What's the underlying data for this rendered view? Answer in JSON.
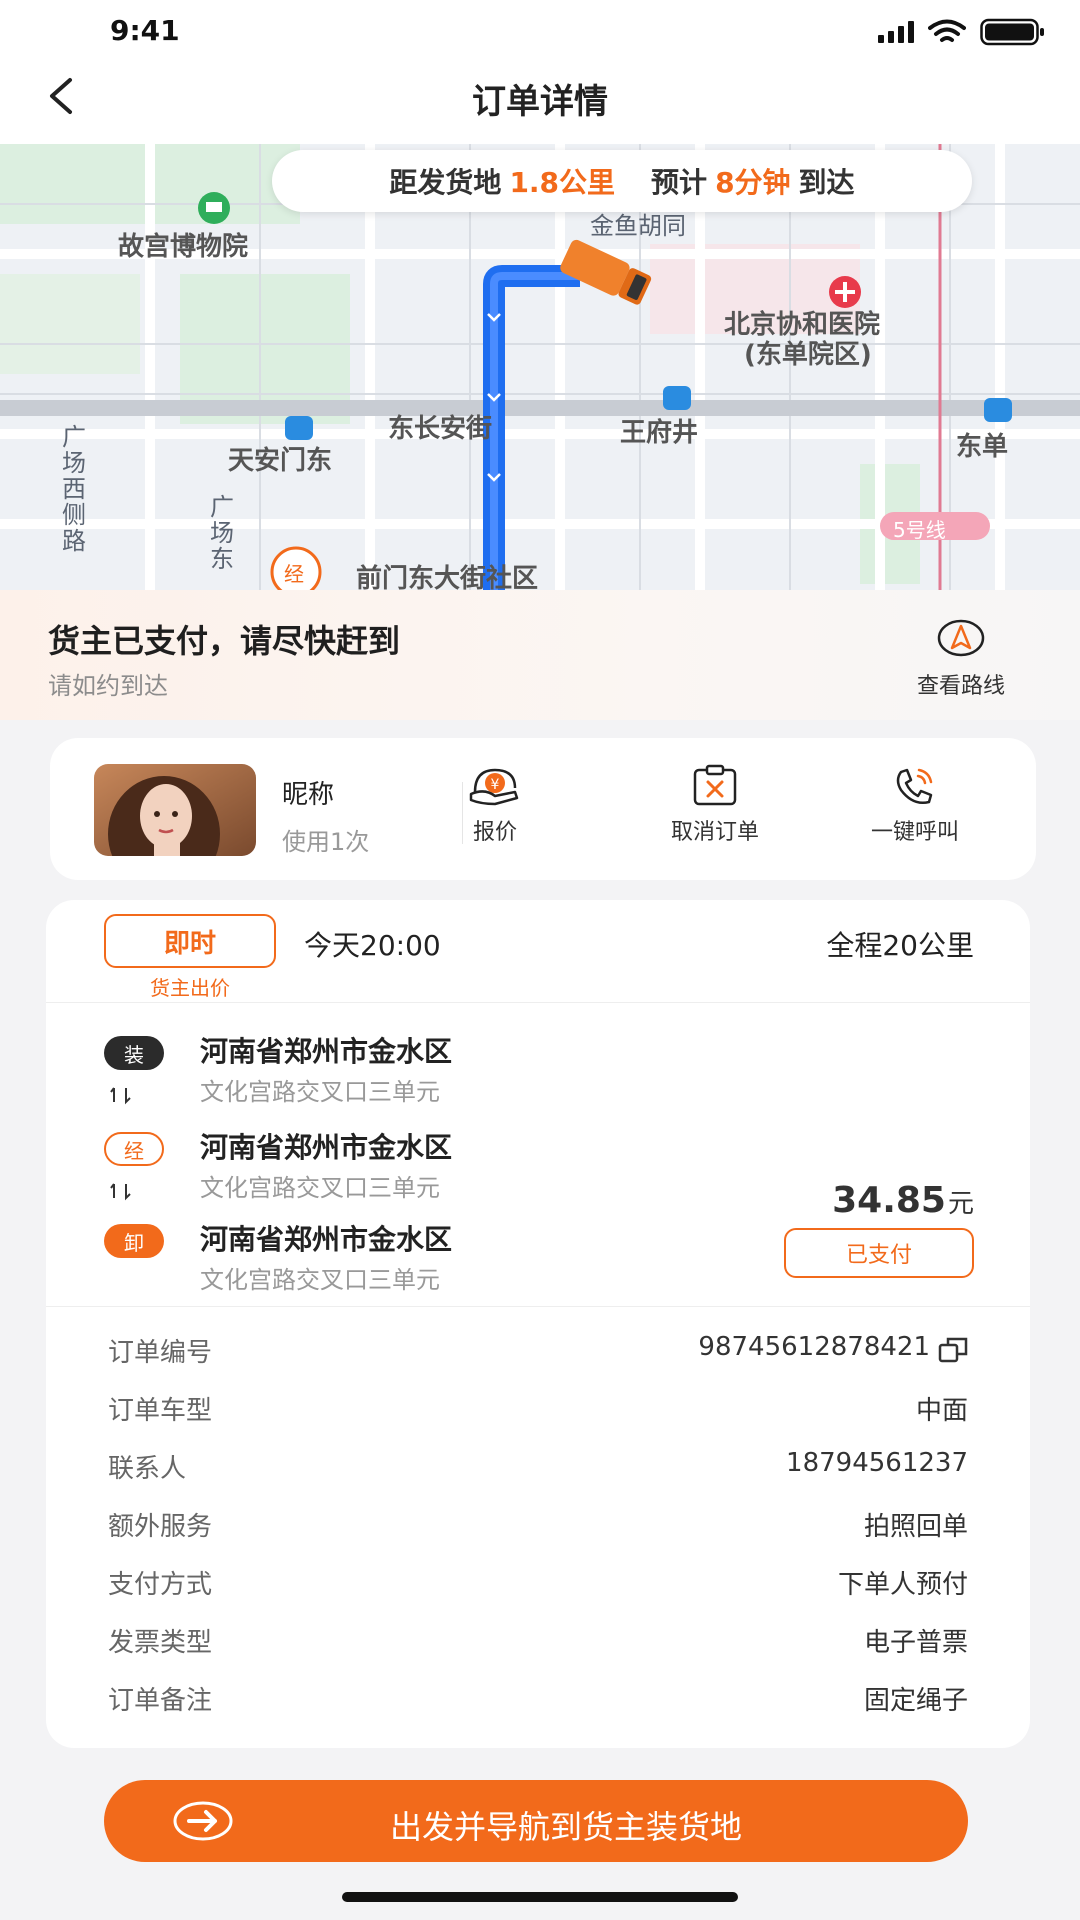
{
  "status_bar": {
    "time": "9:41"
  },
  "nav": {
    "title": "订单详情",
    "back_icon": "‹"
  },
  "map": {
    "labels": {
      "museum": "故宫博物院",
      "hutong": "金鱼胡同",
      "wangfujing_top": "王府井",
      "hospital_line1": "北京协和医院",
      "hospital_line2": "(东单院区)",
      "dongchangan": "东长安街",
      "wangfujing_station": "王府井",
      "tiananmen_east": "天安门东",
      "dongdan": "东单",
      "line5": "5号线",
      "guangchang_west": "广场西侧路",
      "guangchang_east": "广场东",
      "via_badge": "经",
      "community": "前门东大街社区"
    },
    "distance_prefix": "距发货地",
    "distance_value": "1.8公里",
    "eta_prefix": "预计",
    "eta_value": "8分钟",
    "eta_suffix": "到达"
  },
  "status_panel": {
    "title": "货主已支付，请尽快赶到",
    "subtitle": "请如约到达",
    "route_label": "查看路线"
  },
  "shipper": {
    "nickname": "昵称",
    "usage": "使用1次",
    "actions": [
      {
        "label": "报价",
        "icon": "quote-icon"
      },
      {
        "label": "取消订单",
        "icon": "cancel-order-icon"
      },
      {
        "label": "一键呼叫",
        "icon": "phone-call-icon"
      }
    ]
  },
  "order": {
    "tag": "即时",
    "tag_sub": "货主出价",
    "time": "今天20:00",
    "total_distance": "全程20公里",
    "stops": [
      {
        "badge": "装",
        "main": "河南省郑州市金水区",
        "detail": "文化宫路交叉口三单元"
      },
      {
        "badge": "经",
        "main": "河南省郑州市金水区",
        "detail": "文化宫路交叉口三单元"
      },
      {
        "badge": "卸",
        "main": "河南省郑州市金水区",
        "detail": "文化宫路交叉口三单元"
      }
    ],
    "connector": "⇃↾",
    "price": "34.85",
    "price_unit": "元",
    "paid_label": "已支付",
    "info": [
      {
        "label": "订单编号",
        "value": "98745612878421"
      },
      {
        "label": "订单车型",
        "value": "中面"
      },
      {
        "label": "联系人",
        "value": "18794561237"
      },
      {
        "label": "额外服务",
        "value": "拍照回单"
      },
      {
        "label": "支付方式",
        "value": "下单人预付"
      },
      {
        "label": "发票类型",
        "value": "电子普票"
      },
      {
        "label": "订单备注",
        "value": "固定绳子"
      }
    ]
  },
  "cta": {
    "label": "出发并导航到货主装货地"
  },
  "colors": {
    "accent": "#f26a1b",
    "route": "#1f6ef0"
  }
}
